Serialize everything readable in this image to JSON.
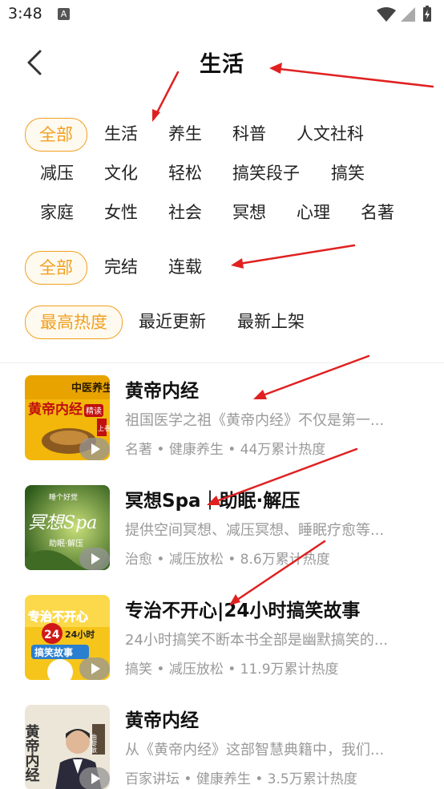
{
  "status_bar": {
    "time": "3:48",
    "notification_icon": "A"
  },
  "header": {
    "title": "生活",
    "back_icon": "chevron-left"
  },
  "filters": {
    "category": [
      "全部",
      "生活",
      "养生",
      "科普",
      "人文社科",
      "减压",
      "文化",
      "轻松",
      "搞笑段子",
      "搞笑",
      "家庭",
      "女性",
      "社会",
      "冥想",
      "心理",
      "名著"
    ],
    "status": [
      "全部",
      "完结",
      "连载"
    ],
    "sort": [
      "最高热度",
      "最近更新",
      "最新上架"
    ]
  },
  "books": [
    {
      "title": "黄帝内经",
      "desc": "祖国医学之祖《黄帝内经》不仅是第一...",
      "meta": "名著 • 健康养生 • 44万累计热度",
      "cover_texts": [
        "中医养生",
        "黄帝内经",
        "精读",
        "上卷"
      ]
    },
    {
      "title": "冥想Spa｜助眠·解压",
      "desc": "提供空间冥想、减压冥想、睡眠疗愈等...",
      "meta": "治愈 • 减压放松 • 8.6万累计热度",
      "cover_texts": [
        "睡个好觉",
        "冥想Spa",
        "助眠·解压"
      ]
    },
    {
      "title": "专治不开心|24小时搞笑故事",
      "desc": "24小时搞笑不断本书全部是幽默搞笑的...",
      "meta": "搞笑 • 减压放松 • 11.9万累计热度",
      "cover_texts": [
        "专治不开心",
        "24小时",
        "搞笑故事"
      ]
    },
    {
      "title": "黄帝内经",
      "desc": "从《黄帝内经》这部智慧典籍中，我们...",
      "meta": "百家讲坛 • 健康养生 • 3.5万累计热度",
      "cover_texts": [
        "黄帝内经",
        "曲黎敏"
      ]
    }
  ],
  "colors": {
    "accent": "#f0a020",
    "annotation_arrow": "#e02020"
  }
}
